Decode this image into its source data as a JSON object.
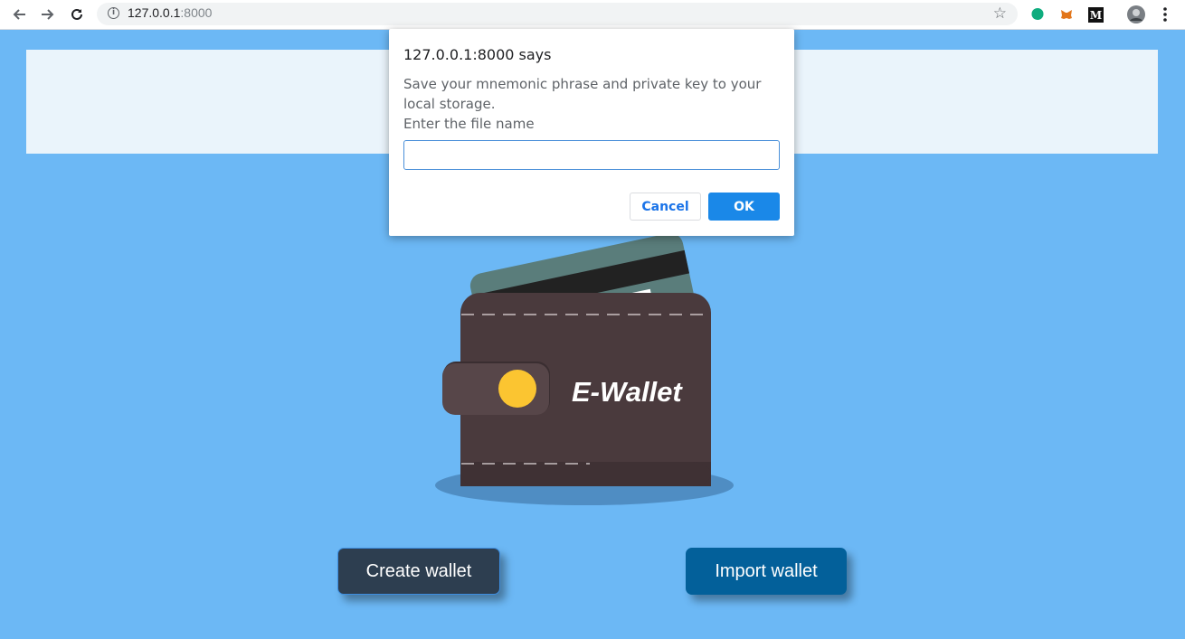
{
  "browser": {
    "url_host": "127.0.0.1",
    "url_port": ":8000",
    "icons": [
      "back-arrow-icon",
      "forward-arrow-icon",
      "reload-icon",
      "info-icon",
      "star-icon",
      "grammarly-extension-icon",
      "metamask-extension-icon",
      "medium-extension-icon",
      "profile-avatar-icon",
      "menu-kebab-icon"
    ]
  },
  "illustration": {
    "wallet_label": "E-Wallet"
  },
  "actions": {
    "create_label": "Create wallet",
    "import_label": "Import wallet"
  },
  "dialog": {
    "title": "127.0.0.1:8000 says",
    "message": "Save your mnemonic phrase and private key to your local storage.\n Enter the file name",
    "input_value": "",
    "cancel_label": "Cancel",
    "ok_label": "OK"
  },
  "colors": {
    "page_bg": "#6cb8f5",
    "banner_bg": "#eaf4fb",
    "create_button": "#2d3e50",
    "import_button": "#03609a",
    "ok_button": "#1a88e8",
    "wallet_body": "#4a3a3d",
    "coin": "#fbc531"
  }
}
